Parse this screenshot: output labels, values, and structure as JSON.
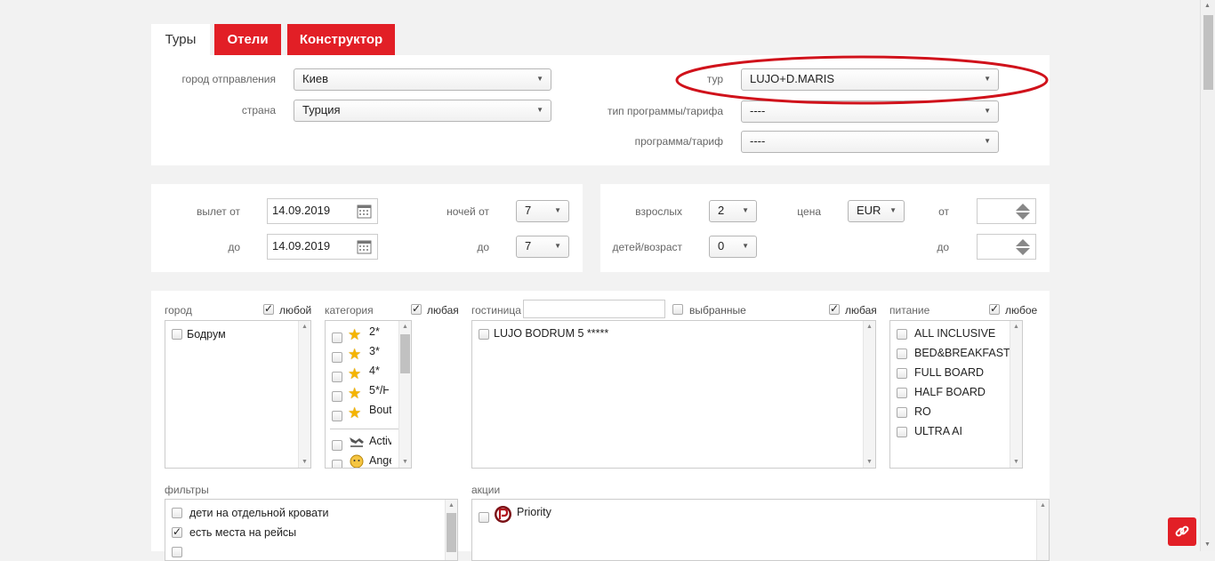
{
  "tabs": [
    {
      "label": "Туры"
    },
    {
      "label": "Отели"
    },
    {
      "label": "Конструктор"
    }
  ],
  "search": {
    "departure_city_label": "город отправления",
    "departure_city_value": "Киев",
    "country_label": "страна",
    "country_value": "Турция",
    "tour_label": "тур",
    "tour_value": "LUJO+D.MARIS",
    "program_type_label": "тип программы/тарифа",
    "program_type_value": "----",
    "program_label": "программа/тариф",
    "program_value": "----"
  },
  "dates": {
    "depart_from_label": "вылет от",
    "depart_from_value": "14.09.2019",
    "depart_to_label": "до",
    "depart_to_value": "14.09.2019",
    "nights_from_label": "ночей от",
    "nights_from_value": "7",
    "nights_to_label": "до",
    "nights_to_value": "7"
  },
  "people": {
    "adults_label": "взрослых",
    "adults_value": "2",
    "children_label": "детей/возраст",
    "children_value": "0",
    "price_label": "цена",
    "currency_value": "EUR",
    "price_from_label": "от",
    "price_to_label": "до"
  },
  "filters": {
    "city_label": "город",
    "city_any": "любой",
    "cities": [
      "Бодрум"
    ],
    "category_label": "категория",
    "category_any": "любая",
    "categories": [
      "2*",
      "3*",
      "4*",
      "5*/H",
      "Bout",
      "Activ",
      "Ange"
    ],
    "hotel_label": "гостиница",
    "hotel_search_value": "",
    "selected_label": "выбранные",
    "hotel_any": "любая",
    "hotels": [
      "LUJO BODRUM 5 *****"
    ],
    "meal_label": "питание",
    "meal_any": "любое",
    "meals": [
      "ALL INCLUSIVE",
      "BED&BREAKFAST",
      "FULL BOARD",
      "HALF BOARD",
      "RO",
      "ULTRA AI"
    ],
    "extra_filters_label": "фильтры",
    "extra_filters": [
      "дети на отдельной кровати",
      "есть места на рейсы"
    ],
    "promos_label": "акции",
    "promos": [
      "Priority"
    ]
  },
  "colors": {
    "accent_red": "#e21f26",
    "annotation_red": "#d0121b",
    "star": "#f5b400"
  }
}
